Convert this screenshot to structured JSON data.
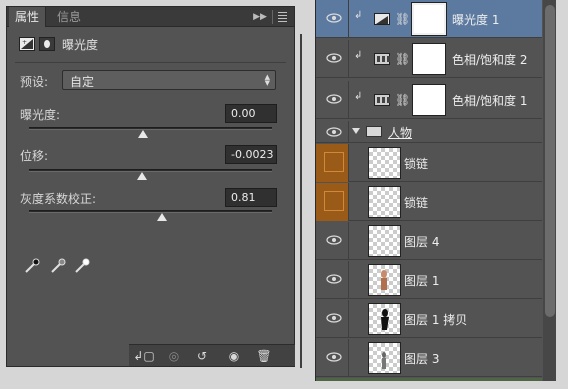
{
  "properties_panel": {
    "tabs": [
      "属性",
      "信息"
    ],
    "title": "曝光度",
    "preset": {
      "label": "预设:",
      "value": "自定"
    },
    "sliders": [
      {
        "label": "曝光度:",
        "value": "0.00"
      },
      {
        "label": "位移:",
        "value": "-0.0023"
      },
      {
        "label": "灰度系数校正:",
        "value": "0.81"
      }
    ],
    "eyedroppers": [
      "black-point-eyedropper-icon",
      "gray-point-eyedropper-icon",
      "white-point-eyedropper-icon"
    ],
    "footer_icons": [
      "clip-to-layer-icon",
      "view-previous-state-icon",
      "reset-icon",
      "visibility-eye-icon",
      "trash-icon"
    ]
  },
  "layers_panel": {
    "layers": [
      {
        "name": "曝光度 1",
        "kind": "adjustment",
        "selected": true
      },
      {
        "name": "色相/饱和度 2",
        "kind": "adjustment"
      },
      {
        "name": "色相/饱和度 1",
        "kind": "adjustment"
      },
      {
        "name": "人物",
        "kind": "group"
      },
      {
        "name": "锁链",
        "kind": "pixel",
        "hidden": true
      },
      {
        "name": "锁链",
        "kind": "pixel",
        "hidden": true
      },
      {
        "name": "图层 4",
        "kind": "pixel"
      },
      {
        "name": "图层 1",
        "kind": "pixel"
      },
      {
        "name": "图层 1 拷贝",
        "kind": "pixel"
      },
      {
        "name": "图层 3",
        "kind": "pixel"
      }
    ]
  },
  "colors": {
    "panel_bg": "#535353",
    "selected_row": "#5c7aa0",
    "hidden_layer_highlight": "#9a5a18"
  }
}
